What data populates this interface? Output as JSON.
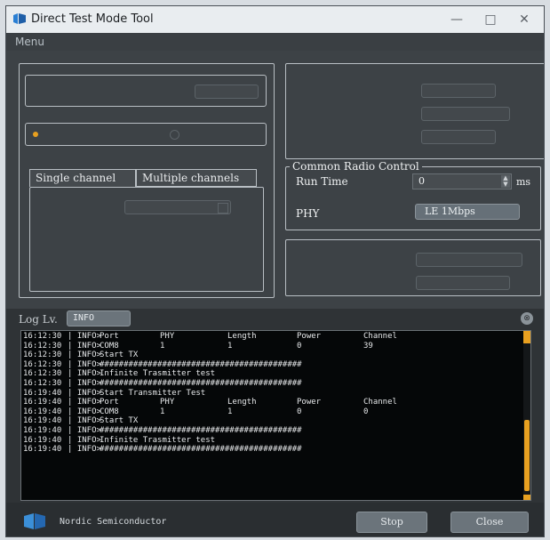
{
  "window": {
    "title": "Direct Test Mode Tool",
    "controls": {
      "minimize": "—",
      "maximize": "□",
      "close": "✕"
    }
  },
  "menu": {
    "label": "Menu"
  },
  "tabs": {
    "single": "Single channel",
    "multiple": "Multiple channels"
  },
  "common_radio": {
    "title": "Common Radio Control",
    "run_time_label": "Run Time",
    "run_time_value": "0",
    "run_time_unit": "ms",
    "phy_label": "PHY",
    "phy_value": "LE 1Mbps"
  },
  "log": {
    "level_label": "Log Lv.",
    "level_value": "INFO",
    "rows": [
      [
        "16:12:30",
        "INFO>",
        "Port",
        "PHY",
        "Length",
        "Power",
        "Channel"
      ],
      [
        "16:12:30",
        "INFO>",
        "COM8",
        "1",
        "1",
        "0",
        "39"
      ],
      [
        "16:12:30",
        "INFO>",
        "Start TX",
        "",
        "",
        "",
        ""
      ],
      [
        "16:12:30",
        "INFO>",
        "##########################################",
        "",
        "",
        "",
        ""
      ],
      [
        "16:12:30",
        "INFO>",
        "Infinite Trasmitter test",
        "",
        "",
        "",
        ""
      ],
      [
        "16:12:30",
        "INFO>",
        "##########################################",
        "",
        "",
        "",
        ""
      ],
      [
        "16:19:40",
        "INFO>",
        "Start Transmitter Test",
        "",
        "",
        "",
        ""
      ],
      [
        "16:19:40",
        "INFO>",
        "Port",
        "PHY",
        "Length",
        "Power",
        "Channel"
      ],
      [
        "16:19:40",
        "INFO>",
        "COM8",
        "1",
        "1",
        "0",
        "0"
      ],
      [
        "16:19:40",
        "INFO>",
        "Start TX",
        "",
        "",
        "",
        ""
      ],
      [
        "16:19:40",
        "INFO>",
        "##########################################",
        "",
        "",
        "",
        ""
      ],
      [
        "16:19:40",
        "INFO>",
        "Infinite Trasmitter test",
        "",
        "",
        "",
        ""
      ],
      [
        "16:19:40",
        "INFO>",
        "##########################################",
        "",
        "",
        "",
        ""
      ]
    ]
  },
  "footer": {
    "brand": "Nordic Semiconductor",
    "stop_label": "Stop",
    "close_label": "Close"
  },
  "colors": {
    "accent": "#e8a020",
    "panel": "#3d4246",
    "log_bg": "#050708"
  }
}
